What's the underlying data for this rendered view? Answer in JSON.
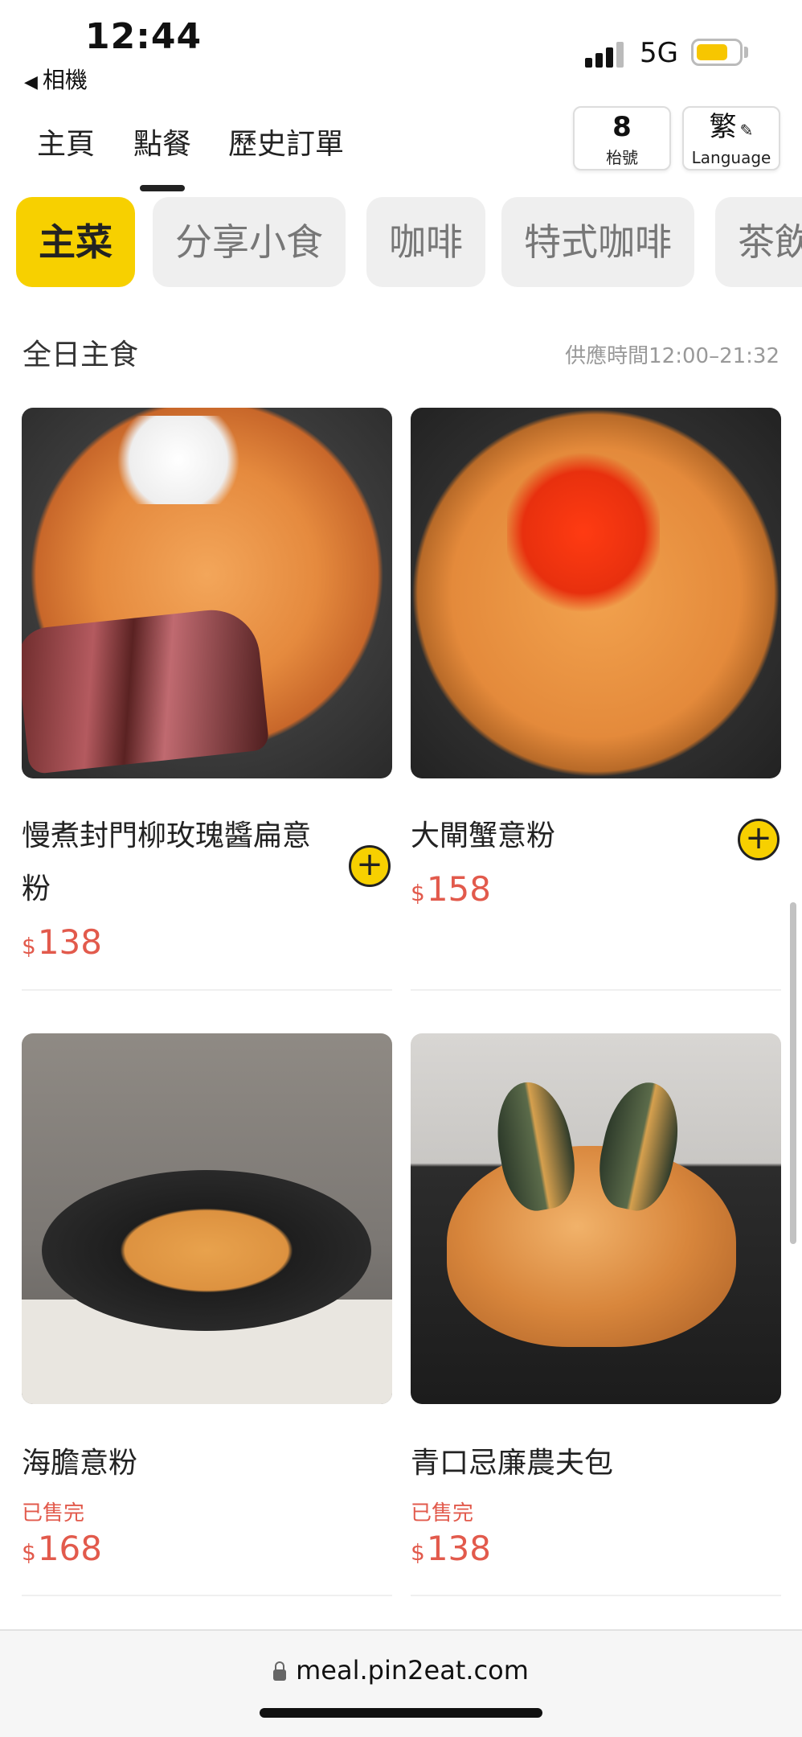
{
  "status": {
    "time": "12:44",
    "back_app": "相機",
    "network": "5G",
    "battery_color": "#f7c600"
  },
  "nav": {
    "tabs": [
      {
        "label": "主頁",
        "active": false
      },
      {
        "label": "點餐",
        "active": true
      },
      {
        "label": "歷史訂單",
        "active": false
      }
    ],
    "table_number": "8",
    "table_label": "枱號",
    "language_char": "繁",
    "language_label": "Language"
  },
  "categories": [
    {
      "label": "主菜",
      "active": true
    },
    {
      "label": "分享小食",
      "active": false
    },
    {
      "label": "咖啡",
      "active": false
    },
    {
      "label": "特式咖啡",
      "active": false
    },
    {
      "label": "茶飲",
      "active": false
    }
  ],
  "section": {
    "title": "全日主食",
    "hours": "供應時間12:00–21:32"
  },
  "products": [
    {
      "name_line1": "慢煮封門柳玫瑰醬扁意",
      "name_line2": "粉",
      "currency": "$",
      "price": "138",
      "status": ""
    },
    {
      "name_line1": "大閘蟹意粉",
      "name_line2": "",
      "currency": "$",
      "price": "158",
      "status": ""
    },
    {
      "name_line1": "海膽意粉",
      "name_line2": "",
      "currency": "$",
      "price": "168",
      "status": "已售完"
    },
    {
      "name_line1": "青口忌廉農夫包",
      "name_line2": "",
      "currency": "$",
      "price": "138",
      "status": "已售完"
    }
  ],
  "add_symbol": "+",
  "browser": {
    "url": "meal.pin2eat.com"
  },
  "colors": {
    "accent": "#f7d000",
    "price": "#e25a4c",
    "chip_inactive": "#efefef"
  }
}
